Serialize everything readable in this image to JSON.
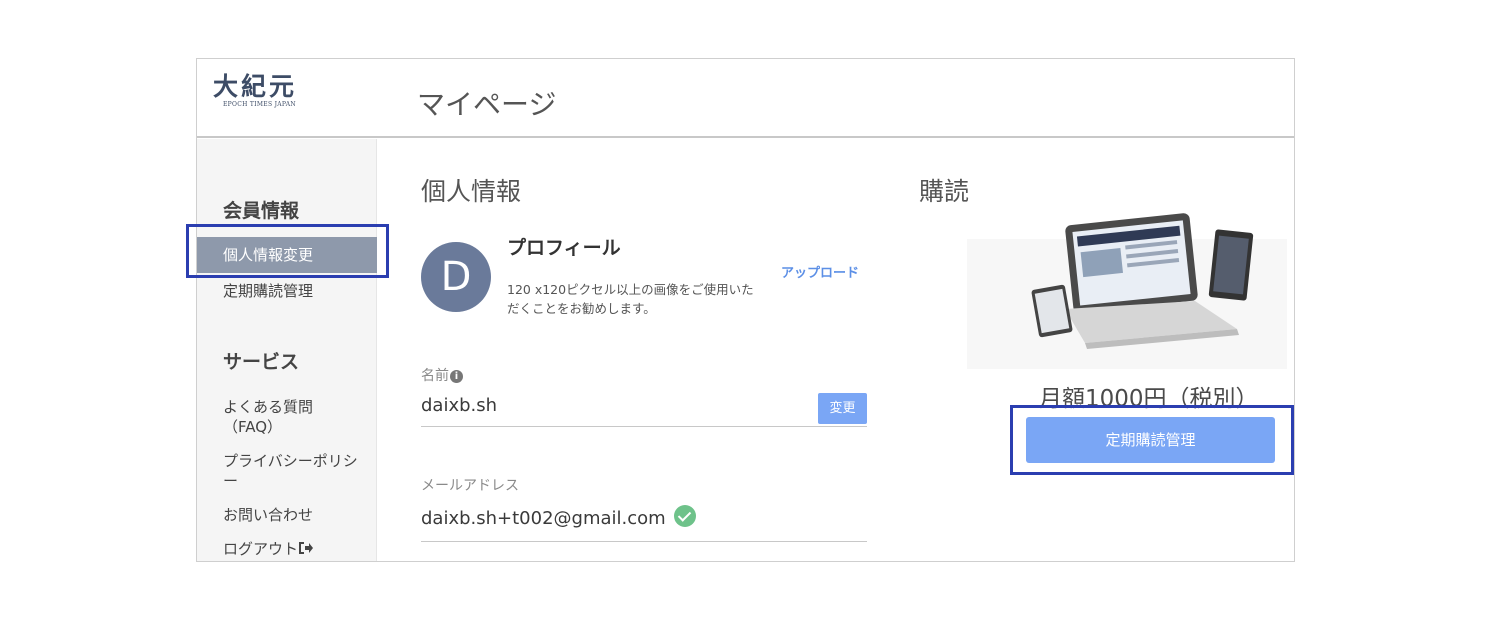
{
  "header": {
    "logo_text": "大紀元",
    "logo_subtext": "EPOCH TIMES JAPAN",
    "page_title": "マイページ"
  },
  "sidebar": {
    "member_heading": "会員情報",
    "member_items": [
      "個人情報変更",
      "定期購読管理"
    ],
    "service_heading": "サービス",
    "service_items": [
      "よくある質問\n（FAQ）",
      "プライバシーポリシー",
      "お問い合わせ",
      "ログアウト"
    ]
  },
  "personal": {
    "title": "個人情報",
    "avatar_letter": "D",
    "profile_title": "プロフィール",
    "profile_desc": "120 x120ピクセル以上の画像をご使用いただくことをお勧めします。",
    "upload_label": "アップロード",
    "name_label": "名前",
    "name_value": "daixb.sh",
    "change_label": "変更",
    "email_label": "メールアドレス",
    "email_value": "daixb.sh+t002@gmail.com"
  },
  "subscription": {
    "title": "購読",
    "price": "月額1000円（税別）",
    "manage_button": "定期購読管理"
  },
  "colors": {
    "accent": "#7aa6f5",
    "highlight": "#2b3eb0",
    "active_item": "#8e99ab",
    "avatar": "#6a7a9a",
    "verified": "#6ec28a"
  },
  "icons": [
    "info-icon",
    "check-icon",
    "logout-icon"
  ]
}
